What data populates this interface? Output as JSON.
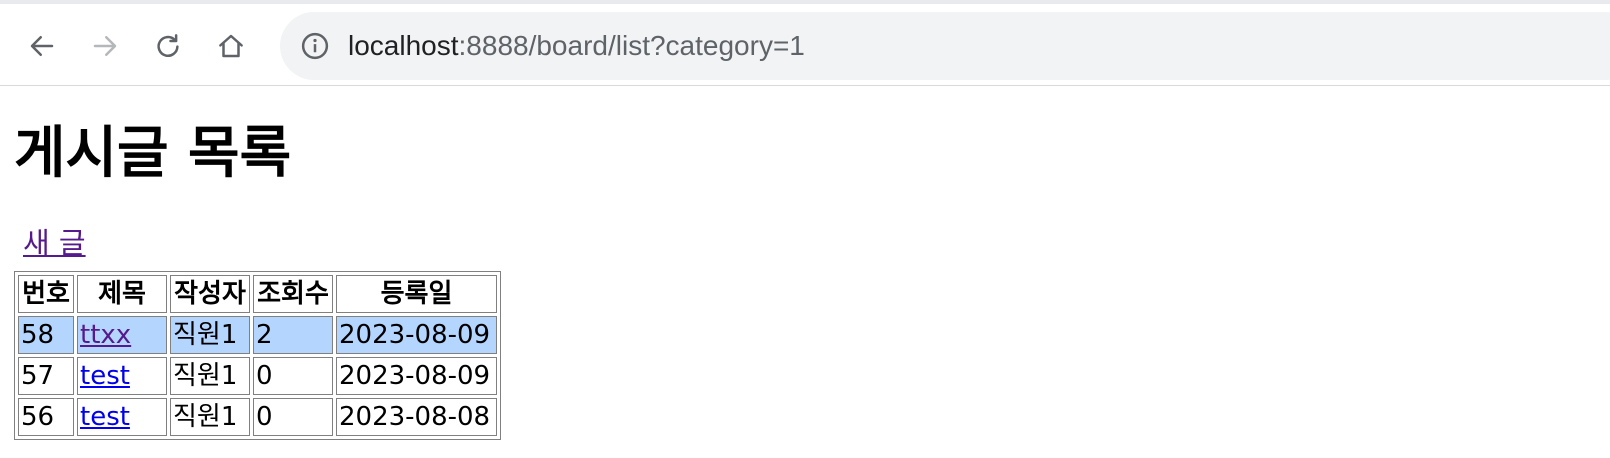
{
  "browser": {
    "back_icon": "arrow-left-icon",
    "forward_icon": "arrow-right-icon",
    "reload_icon": "reload-icon",
    "home_icon": "home-icon",
    "info_icon": "info-circle-icon",
    "url_host": "localhost",
    "url_rest": ":8888/board/list?category=1"
  },
  "page": {
    "title": "게시글 목록",
    "new_post_link": "새 글"
  },
  "table": {
    "headers": {
      "no": "번호",
      "title": "제목",
      "writer": "작성자",
      "views": "조회수",
      "date": "등록일"
    },
    "rows": [
      {
        "no": "58",
        "title": "ttxx",
        "writer": "직원1",
        "views": "2",
        "date": "2023-08-09"
      },
      {
        "no": "57",
        "title": "test",
        "writer": "직원1",
        "views": "0",
        "date": "2023-08-09"
      },
      {
        "no": "56",
        "title": "test",
        "writer": "직원1",
        "views": "0",
        "date": "2023-08-08"
      }
    ]
  },
  "colors": {
    "link": "#0000ee",
    "visited_link": "#551a8b",
    "selection": "#b4d5fe",
    "omnibox_bg": "#f1f3f4"
  }
}
